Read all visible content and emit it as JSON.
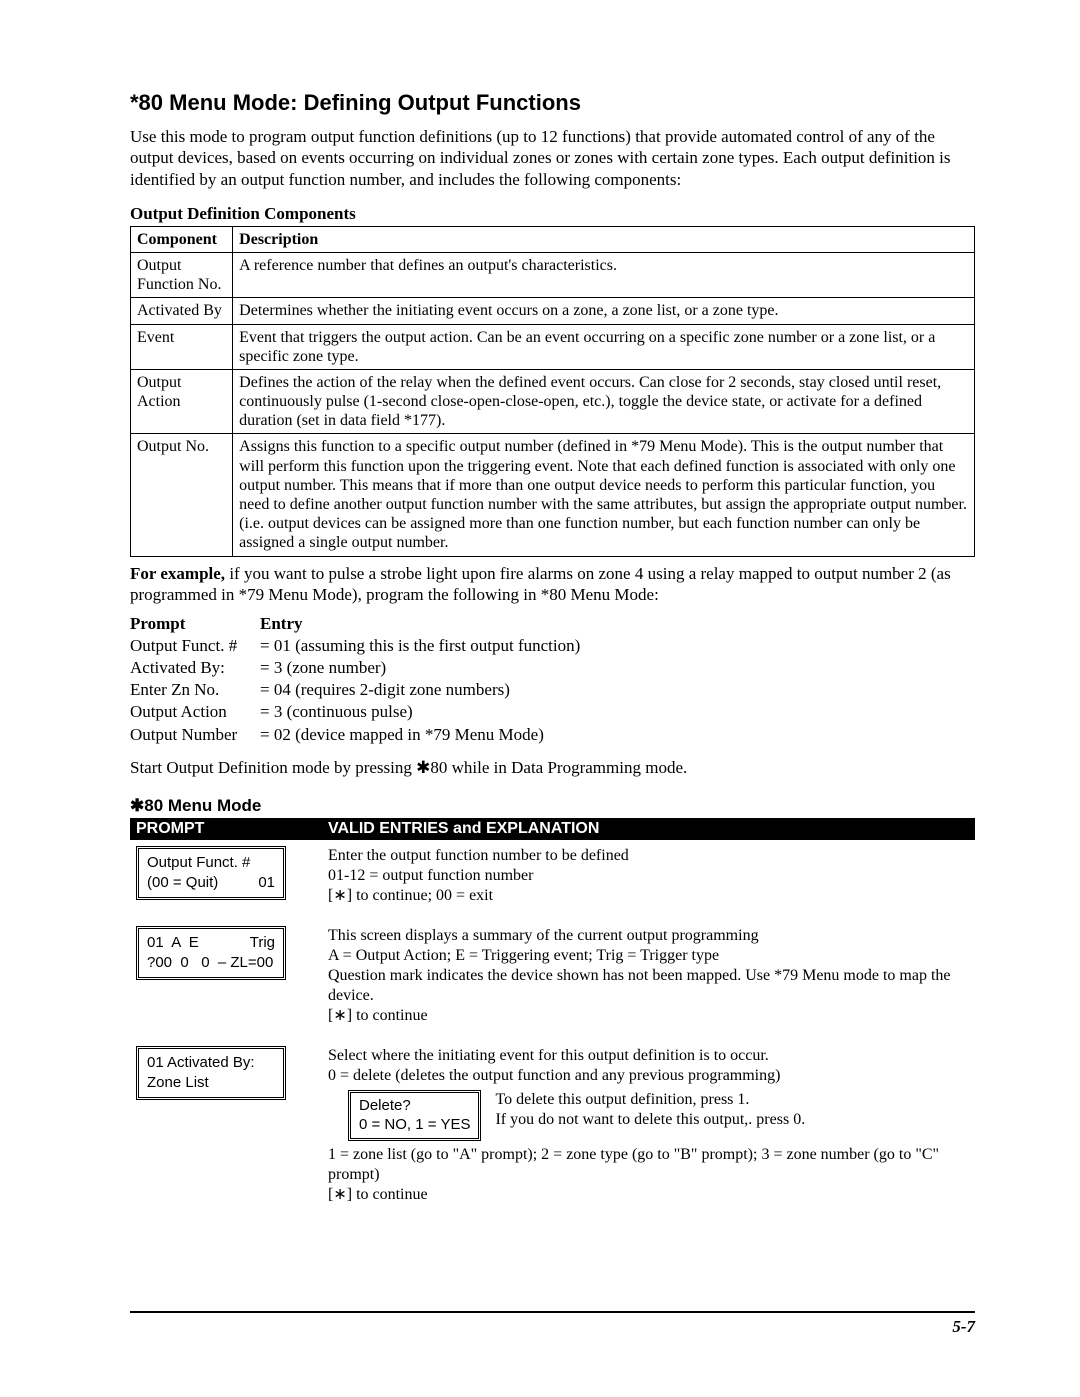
{
  "title": "*80 Menu Mode: Defining Output Functions",
  "intro": "Use this mode to program output function definitions (up to 12 functions) that provide automated control of any of the output devices, based on events occurring on individual zones or zones with certain zone types. Each output definition is identified by an output function number, and includes the following components:",
  "components_heading": "Output Definition Components",
  "components_headers": {
    "c1": "Component",
    "c2": "Description"
  },
  "components": [
    {
      "name": "Output Function No.",
      "desc": "A reference number that defines an output's characteristics."
    },
    {
      "name": "Activated By",
      "desc": "Determines whether the initiating event occurs on a zone, a zone list, or a zone type."
    },
    {
      "name": "Event",
      "desc": "Event that triggers the output action. Can be an event occurring on a specific zone number or a zone list, or a specific zone type."
    },
    {
      "name": "Output Action",
      "desc": "Defines the action of the relay when the defined event occurs. Can close for 2 seconds, stay closed until reset, continuously pulse (1-second close-open-close-open, etc.), toggle the device state, or activate for a defined duration (set in data field *177)."
    },
    {
      "name": "Output No.",
      "desc": "Assigns this function to a specific output number (defined in *79 Menu Mode). This is the output number that will perform this function upon the triggering event. Note that each defined function is associated with only one output number. This means that if more than one output device needs to perform this particular function, you need to define another output function number with the same attributes, but assign the appropriate output number. (i.e. output devices can be assigned more than one function number, but each function number can only be assigned a single output number."
    }
  ],
  "example_lead": "For example,",
  "example_text": " if you want to pulse a strobe light upon fire alarms on zone 4 using a relay mapped to output number 2 (as programmed in *79 Menu Mode), program the following in *80 Menu Mode:",
  "pe_head": {
    "c1": "Prompt",
    "c2": "Entry"
  },
  "pe_rows": [
    {
      "p": "Output Funct. #",
      "e": "= 01 (assuming this is the first output function)"
    },
    {
      "p": "Activated By:",
      "e": "= 3 (zone number)"
    },
    {
      "p": "Enter Zn No.",
      "e": "= 04 (requires 2-digit zone numbers)"
    },
    {
      "p": "Output Action",
      "e": "= 3 (continuous pulse)"
    },
    {
      "p": "Output Number",
      "e": "= 02 (device mapped in *79 Menu Mode)"
    }
  ],
  "start_line_a": "Start Output Definition mode by pressing ",
  "start_line_star": "✱",
  "start_line_b": "80 while in Data Programming mode.",
  "menu_heading_star": "✱",
  "menu_heading": "80 Menu Mode",
  "menu_headers": {
    "c1": "PROMPT",
    "c2": "VALID ENTRIES and EXPLANATION"
  },
  "menu_rows": [
    {
      "lcd": {
        "l1a": "Output Funct. #",
        "l1b": "",
        "l2a": "(00 = Quit)",
        "l2b": "01"
      },
      "expl": "Enter the output function number to be defined\n01-12 = output function number\n[∗] to continue; 00 = exit"
    },
    {
      "lcd": {
        "l1a": "01  A  E",
        "l1b": "Trig",
        "l2a": "?00  0   0  – ZL=00",
        "l2b": ""
      },
      "expl": "This screen displays a summary of the current output programming\nA = Output Action; E = Triggering event; Trig = Trigger type\nQuestion mark indicates the device shown has not been mapped. Use *79 Menu mode to map the device.\n[∗] to continue"
    },
    {
      "lcd": {
        "l1a": "01 Activated By:",
        "l1b": "",
        "l2a": "Zone List",
        "l2b": ""
      },
      "expl_top": "Select where the initiating event for this output definition is to occur.\n0 = delete (deletes the output function and any previous programming)",
      "delete_lcd": {
        "l1": "Delete?",
        "l2": "0 = NO,  1 = YES"
      },
      "delete_text1": "To delete this output definition, press 1.",
      "delete_text2": "If you do not want to delete this output,. press 0.",
      "expl_bottom": "1 = zone list (go to \"A\" prompt); 2 = zone type (go to \"B\" prompt); 3 = zone number (go to \"C\" prompt)\n[∗] to continue"
    }
  ],
  "page_number": "5-7"
}
